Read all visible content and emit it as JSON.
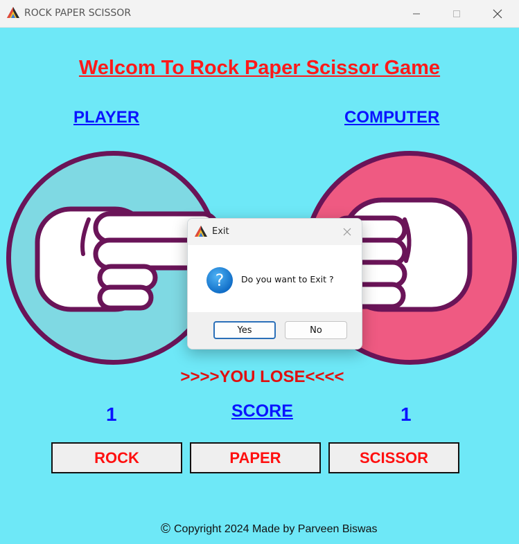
{
  "window": {
    "title": "ROCK PAPER SCISSOR",
    "icon": "app-pyramid-icon"
  },
  "game": {
    "heading": "Welcom To Rock Paper Scissor Game",
    "player_label": "PLAYER",
    "computer_label": "COMPUTER",
    "player_hand": "scissor",
    "computer_hand": "rock",
    "result": ">>>>YOU LOSE<<<<",
    "score_label": "SCORE",
    "player_score": "1",
    "computer_score": "1"
  },
  "choices": {
    "rock": "ROCK",
    "paper": "PAPER",
    "scissor": "SCISSOR"
  },
  "footer": {
    "copyright": "Copyright 2024 Made by Parveen Biswas",
    "icon": "copyright-icon"
  },
  "dialog": {
    "title": "Exit",
    "message": "Do you want to Exit ?",
    "yes_label": "Yes",
    "no_label": "No",
    "icon": "question-icon"
  },
  "colors": {
    "background": "#6ee8f7",
    "heading": "#ff1a1a",
    "labels": "#0a14ff",
    "player_circle": "#7fd9e3",
    "computer_circle": "#ef5a82",
    "circle_border": "#6a1458",
    "result": "#e01010"
  }
}
